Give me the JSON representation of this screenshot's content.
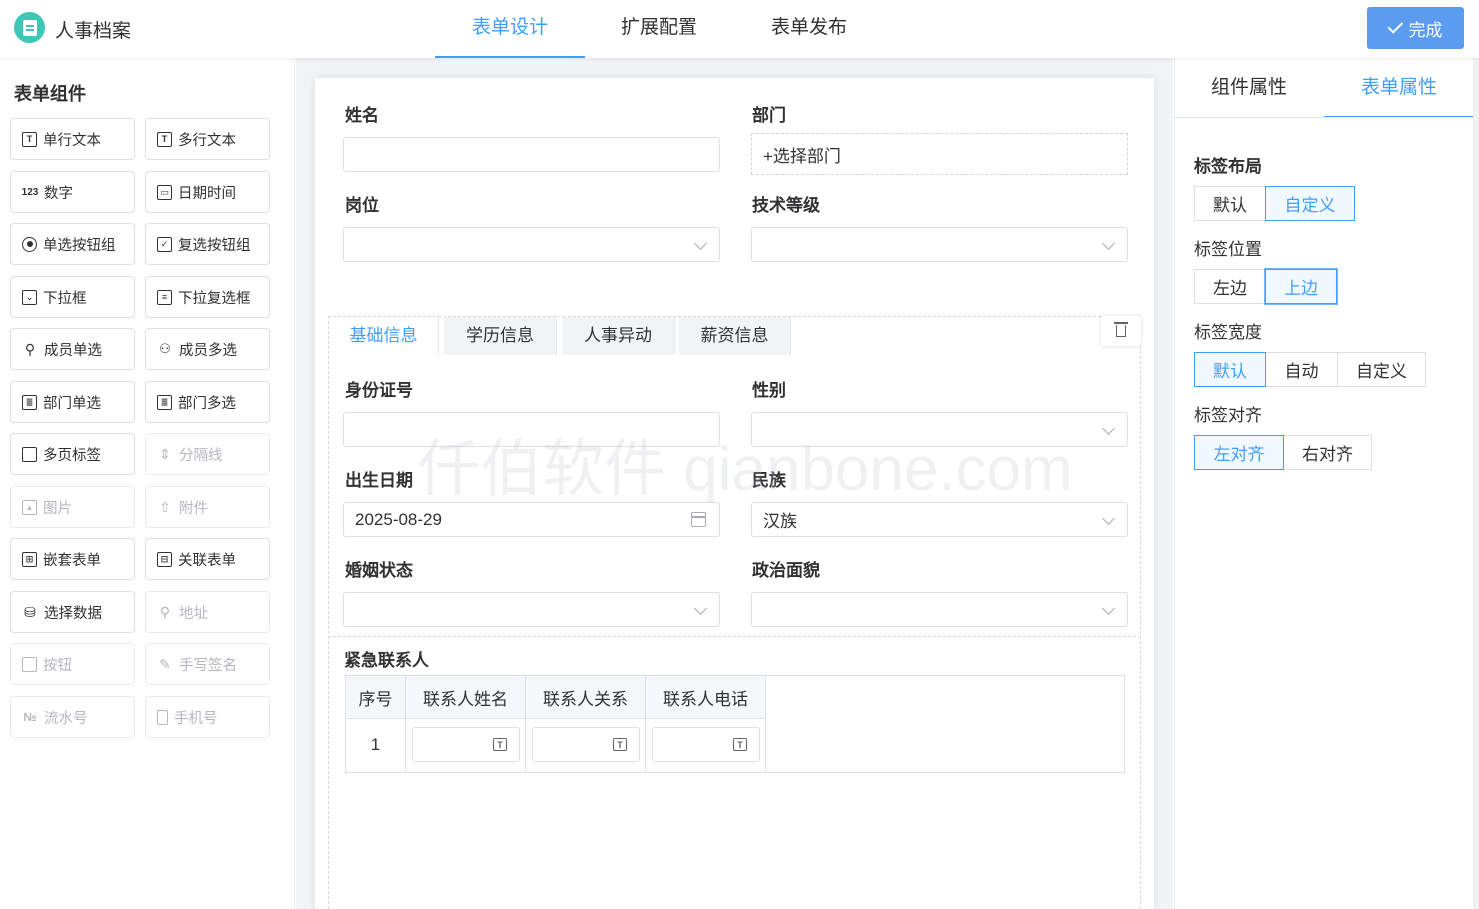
{
  "header": {
    "app_title": "人事档案",
    "tabs": [
      {
        "label": "表单设计",
        "active": true
      },
      {
        "label": "扩展配置",
        "active": false
      },
      {
        "label": "表单发布",
        "active": false
      }
    ],
    "done_label": "完成"
  },
  "left_panel": {
    "title": "表单组件",
    "components": [
      {
        "label": "单行文本",
        "icon": "single-text-icon",
        "enabled": true
      },
      {
        "label": "多行文本",
        "icon": "multi-text-icon",
        "enabled": true
      },
      {
        "label": "数字",
        "icon": "number-icon",
        "enabled": true
      },
      {
        "label": "日期时间",
        "icon": "calendar-icon",
        "enabled": true
      },
      {
        "label": "单选按钮组",
        "icon": "radio-icon",
        "enabled": true
      },
      {
        "label": "复选按钮组",
        "icon": "checkbox-icon",
        "enabled": true
      },
      {
        "label": "下拉框",
        "icon": "dropdown-icon",
        "enabled": true
      },
      {
        "label": "下拉复选框",
        "icon": "dropdown-multi-icon",
        "enabled": true
      },
      {
        "label": "成员单选",
        "icon": "user-icon",
        "enabled": true
      },
      {
        "label": "成员多选",
        "icon": "users-icon",
        "enabled": true
      },
      {
        "label": "部门单选",
        "icon": "dept-card-icon",
        "enabled": true
      },
      {
        "label": "部门多选",
        "icon": "dept-multi-icon",
        "enabled": true
      },
      {
        "label": "多页标签",
        "icon": "tabs-icon",
        "enabled": true
      },
      {
        "label": "分隔线",
        "icon": "divider-icon",
        "enabled": false
      },
      {
        "label": "图片",
        "icon": "image-icon",
        "enabled": false
      },
      {
        "label": "附件",
        "icon": "upload-icon",
        "enabled": false
      },
      {
        "label": "嵌套表单",
        "icon": "nested-form-icon",
        "enabled": true
      },
      {
        "label": "关联表单",
        "icon": "linked-form-icon",
        "enabled": true
      },
      {
        "label": "选择数据",
        "icon": "database-icon",
        "enabled": true
      },
      {
        "label": "地址",
        "icon": "location-icon",
        "enabled": false
      },
      {
        "label": "按钮",
        "icon": "button-icon",
        "enabled": false
      },
      {
        "label": "手写签名",
        "icon": "signature-icon",
        "enabled": false
      },
      {
        "label": "流水号",
        "icon": "serial-number-icon",
        "enabled": false
      },
      {
        "label": "手机号",
        "icon": "phone-icon",
        "enabled": false
      }
    ]
  },
  "form": {
    "name_label": "姓名",
    "dept_label": "部门",
    "dept_placeholder": "+选择部门",
    "position_label": "岗位",
    "tech_level_label": "技术等级",
    "subtabs": [
      {
        "label": "基础信息",
        "active": true
      },
      {
        "label": "学历信息",
        "active": false
      },
      {
        "label": "人事异动",
        "active": false
      },
      {
        "label": "薪资信息",
        "active": false
      }
    ],
    "id_label": "身份证号",
    "gender_label": "性别",
    "birth_label": "出生日期",
    "birth_value": "2025-08-29",
    "ethnic_label": "民族",
    "ethnic_value": "汉族",
    "marital_label": "婚姻状态",
    "political_label": "政治面貌",
    "contact_title": "紧急联系人",
    "contact_table": {
      "headers": [
        "序号",
        "联系人姓名",
        "联系人关系",
        "联系人电话"
      ],
      "rows": [
        {
          "index": "1"
        }
      ]
    }
  },
  "watermark": "仟伯软件 qianbone.com",
  "right_panel": {
    "tabs": [
      {
        "label": "组件属性",
        "active": false
      },
      {
        "label": "表单属性",
        "active": true
      }
    ],
    "label_layout": {
      "title": "标签布局",
      "options": [
        "默认",
        "自定义"
      ],
      "selected": "自定义"
    },
    "label_position": {
      "title": "标签位置",
      "options": [
        "左边",
        "上边"
      ],
      "selected": "上边"
    },
    "label_width": {
      "title": "标签宽度",
      "options": [
        "默认",
        "自动",
        "自定义"
      ],
      "selected": "默认"
    },
    "label_align": {
      "title": "标签对齐",
      "options": [
        "左对齐",
        "右对齐"
      ],
      "selected": "左对齐"
    }
  },
  "colors": {
    "accent": "#409eff",
    "done_button": "#5b9cf0",
    "logo": "#3ec7b5"
  }
}
